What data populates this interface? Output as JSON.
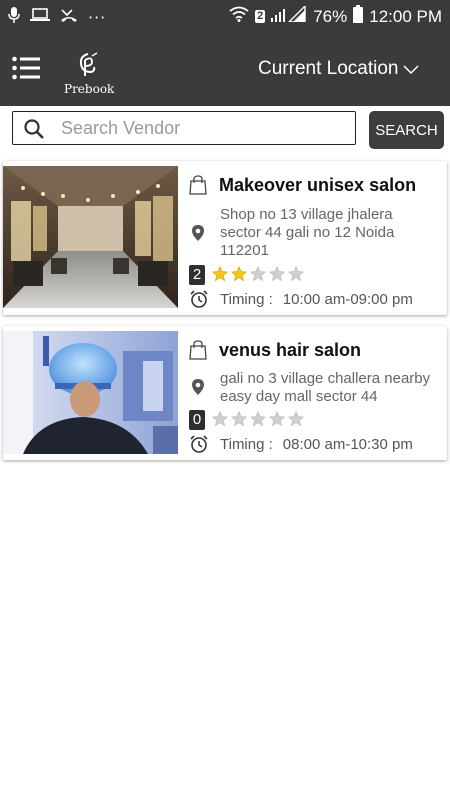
{
  "status_bar": {
    "sim_badge": "2",
    "battery": "76%",
    "time": "12:00 PM",
    "dots": "···"
  },
  "app_bar": {
    "logo_text": "Prebook",
    "location_label": "Current Location",
    "background": "#3b3b3b"
  },
  "search": {
    "placeholder": "Search Vendor",
    "value": "",
    "button_label": "SEARCH"
  },
  "vendors": [
    {
      "name": "Makeover unisex salon",
      "address": "Shop no 13  village jhalera sector 44 gali no 12 Noida 112201",
      "rating_count": "2",
      "rating": 2,
      "max_rating": 5,
      "timing_label": "Timing :",
      "timing": "10:00 am-09:00 pm",
      "image": "salon-interior"
    },
    {
      "name": "venus hair salon",
      "address": "gali no 3 village challera nearby easy day mall sector 44",
      "rating_count": "0",
      "rating": 0,
      "max_rating": 5,
      "timing_label": "Timing :",
      "timing": "08:00 am-10:30 pm",
      "image": "customer-under-hair-steamer"
    }
  ],
  "colors": {
    "star_filled": "#f5c518",
    "star_empty": "#cfcfcf",
    "dark": "#3b3b3b"
  }
}
